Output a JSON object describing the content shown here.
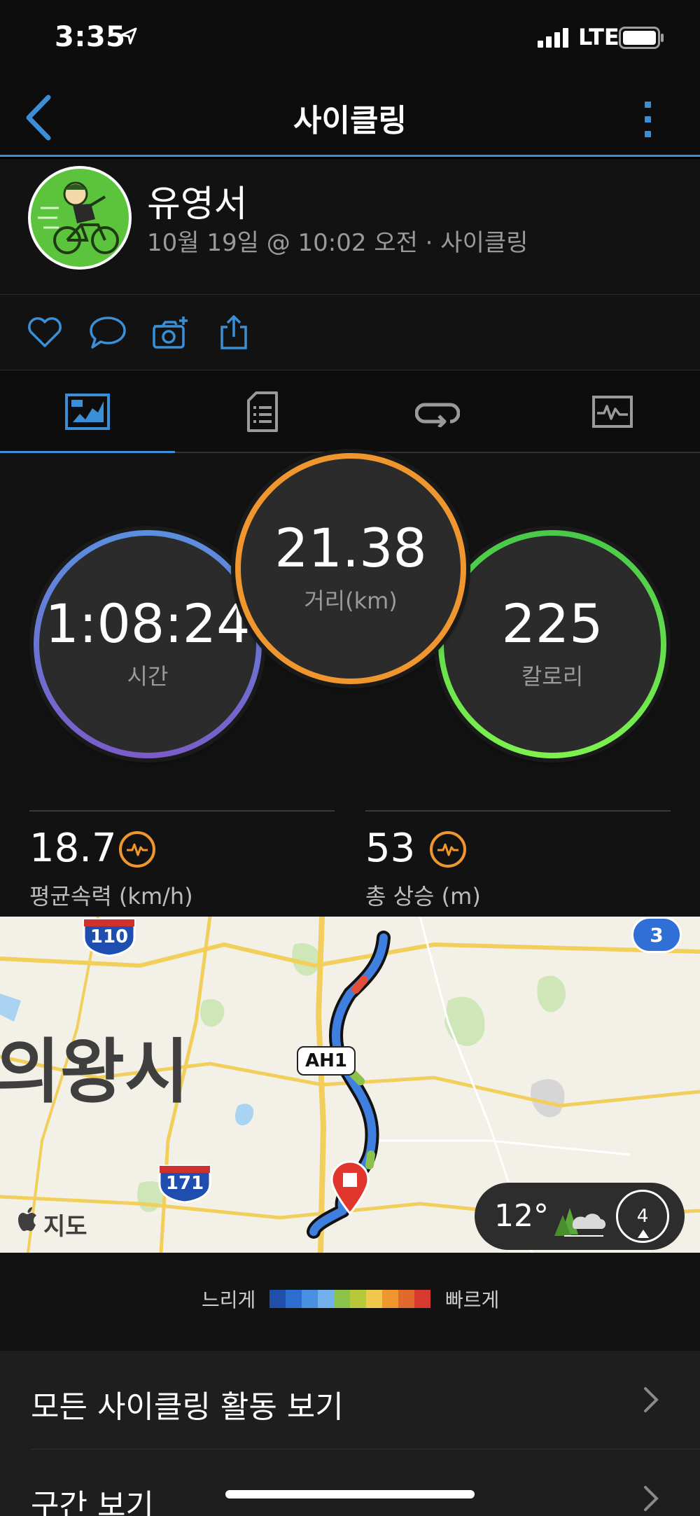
{
  "status_bar": {
    "time": "3:35",
    "network": "LTE"
  },
  "nav": {
    "title": "사이클링"
  },
  "profile": {
    "name": "유영서",
    "meta": "10월 19일 @ 10:02 오전 · 사이클링"
  },
  "rings": {
    "time": {
      "value": "1:08:24",
      "label": "시간"
    },
    "distance": {
      "value": "21.38",
      "label": "거리(km)"
    },
    "calories": {
      "value": "225",
      "label": "칼로리"
    }
  },
  "metrics": {
    "avg_speed": {
      "value": "18.7",
      "label": "평균속력 (km/h)"
    },
    "elevation": {
      "value": "53",
      "label": "총 상승 (m)"
    }
  },
  "map": {
    "city": "의왕시",
    "road_ah": "AH1",
    "shield_110": "110",
    "shield_171": "171",
    "shield_3": "3",
    "attribution": "지도",
    "weather_temp": "12°",
    "wind_speed": "4"
  },
  "legend": {
    "slow": "느리게",
    "fast": "빠르게",
    "colors": [
      "#1f4fa8",
      "#2e6dd0",
      "#4a90e2",
      "#72b0ec",
      "#8bc34a",
      "#b7c93a",
      "#efc94c",
      "#f0962e",
      "#e06a2c",
      "#d63a2f"
    ]
  },
  "list": {
    "items": [
      "모든 사이클링 활동 보기",
      "구간 보기"
    ]
  },
  "colors": {
    "accent": "#3a8fd6",
    "time_ring": "#5b8fe0",
    "distance_ring": "#f0962e",
    "calorie_ring": "#5cd94a"
  }
}
